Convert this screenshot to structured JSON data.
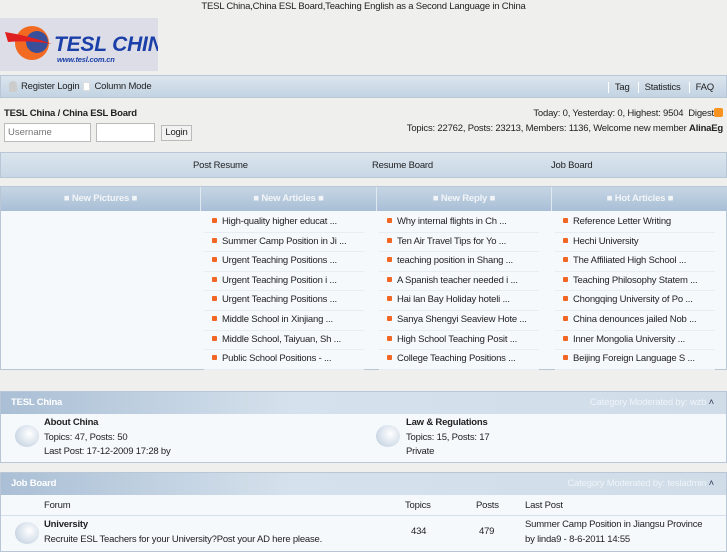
{
  "page_title": "TESL China,China ESL Board,Teaching English as a Second Language in China",
  "logo": {
    "text": "TESL CHINA",
    "url_text": "www.tesl.com.cn"
  },
  "nav": {
    "register_login": "Register Login",
    "column_mode": "Column Mode",
    "right": [
      "Tag",
      "Statistics",
      "FAQ"
    ]
  },
  "breadcrumb": "TESL China / China ESL Board",
  "login": {
    "username_placeholder": "Username",
    "password_value": "",
    "button": "Login"
  },
  "stats": {
    "line1": "Today: 0, Yesterday: 0, Highest: 9504",
    "digest": "Digest",
    "line2": "Topics: 22762, Posts: 23213, Members: 1136, Welcome new member ",
    "new_member": "AlinaEg"
  },
  "menu": [
    "Post Resume",
    "Resume Board",
    "Job Board"
  ],
  "portal": {
    "headers": [
      "New Pictures",
      "New Articles",
      "New Reply",
      "Hot Articles"
    ],
    "new_articles": [
      "High-quality higher educat ...",
      "Summer Camp Position in Ji ...",
      "Urgent Teaching Positions ...",
      "Urgent Teaching Position i ...",
      "Urgent Teaching Positions ...",
      "Middle School in Xinjiang ...",
      "Middle School, Taiyuan, Sh ...",
      "Public School Positions - ..."
    ],
    "new_reply": [
      "Why internal flights in Ch ...",
      "Ten Air Travel Tips for Yo ...",
      "teaching position in Shang ...",
      "A Spanish teacher needed i ...",
      "Hai lan Bay Holiday hoteli ...",
      "Sanya Shengyi Seaview Hote ...",
      "High School Teaching Posit ...",
      "College Teaching Positions ..."
    ],
    "hot_articles": [
      "Reference Letter Writing",
      "Hechi University",
      "The Affiliated High School ...",
      "Teaching Philosophy Statem ...",
      "Chongqing University of Po ...",
      "China denounces jailed Nob ...",
      "Inner Mongolia University ...",
      "Beijing Foreign Language S ..."
    ]
  },
  "cat1": {
    "name": "TESL China",
    "moderator": "Category Moderated by: wzb",
    "forums": [
      {
        "name": "About China",
        "stats": "Topics: 47, Posts: 50",
        "extra": "Last Post: 17-12-2009 17:28 by"
      },
      {
        "name": "Law & Regulations",
        "stats": "Topics: 15, Posts: 17",
        "extra": "Private"
      }
    ]
  },
  "cat2": {
    "name": "Job Board",
    "moderator": "Category Moderated by: tesladmin",
    "columns": [
      "Forum",
      "Topics",
      "Posts",
      "Last Post"
    ],
    "rows": [
      {
        "name": "University",
        "desc": "Recruite ESL Teachers for your University?Post your AD here please.",
        "topics": "434",
        "posts": "479",
        "last_title": "Summer Camp Position in Jiangsu Province",
        "last_by": "by linda9 - 8-6-2011 14:55"
      }
    ]
  }
}
